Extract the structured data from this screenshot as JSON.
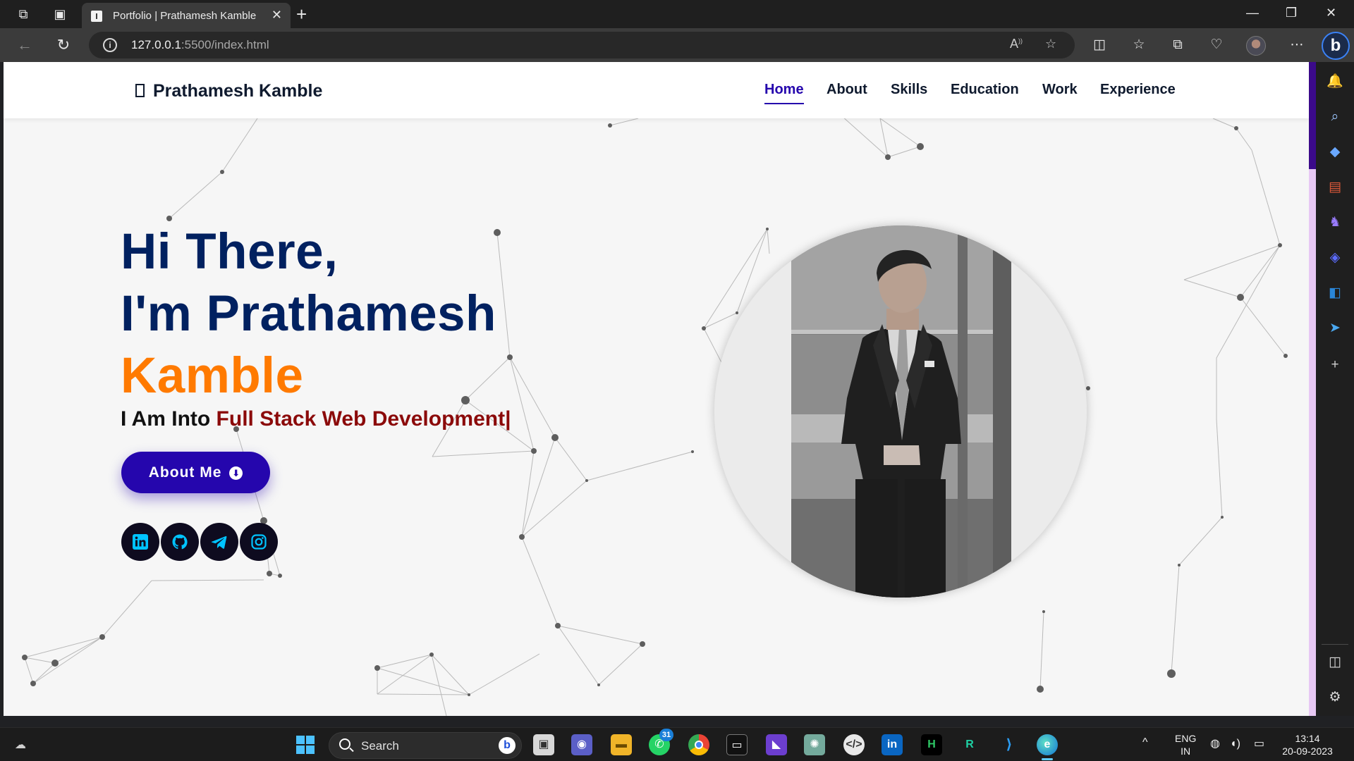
{
  "browser": {
    "tab_title": "Portfolio | Prathamesh Kamble",
    "url_host": "127.0.0.1",
    "url_path": ":5500/index.html"
  },
  "site": {
    "brand": "Prathamesh Kamble",
    "nav": [
      {
        "label": "Home",
        "active": true
      },
      {
        "label": "About",
        "active": false
      },
      {
        "label": "Skills",
        "active": false
      },
      {
        "label": "Education",
        "active": false
      },
      {
        "label": "Work",
        "active": false
      },
      {
        "label": "Experience",
        "active": false
      }
    ],
    "hero": {
      "line1": "Hi There,",
      "line2": "I'm Prathamesh",
      "line3": "Kamble",
      "intro": "I Am Into ",
      "typed": "Full Stack Web Development|",
      "button_label": "About Me"
    },
    "socials": [
      {
        "icon": "linkedin-icon"
      },
      {
        "icon": "github-icon"
      },
      {
        "icon": "telegram-icon"
      },
      {
        "icon": "instagram-icon"
      }
    ],
    "colors": {
      "primary": "#2506ad",
      "heading": "#012160",
      "accent_name": "#ff7a00",
      "typed_text": "#8b0a0a",
      "social_icon": "#00c3ff"
    }
  },
  "taskbar": {
    "search_label": "Search",
    "whatsapp_badge": "31",
    "language": "ENG",
    "region": "IN",
    "time": "13:14",
    "date": "20-09-2023"
  }
}
